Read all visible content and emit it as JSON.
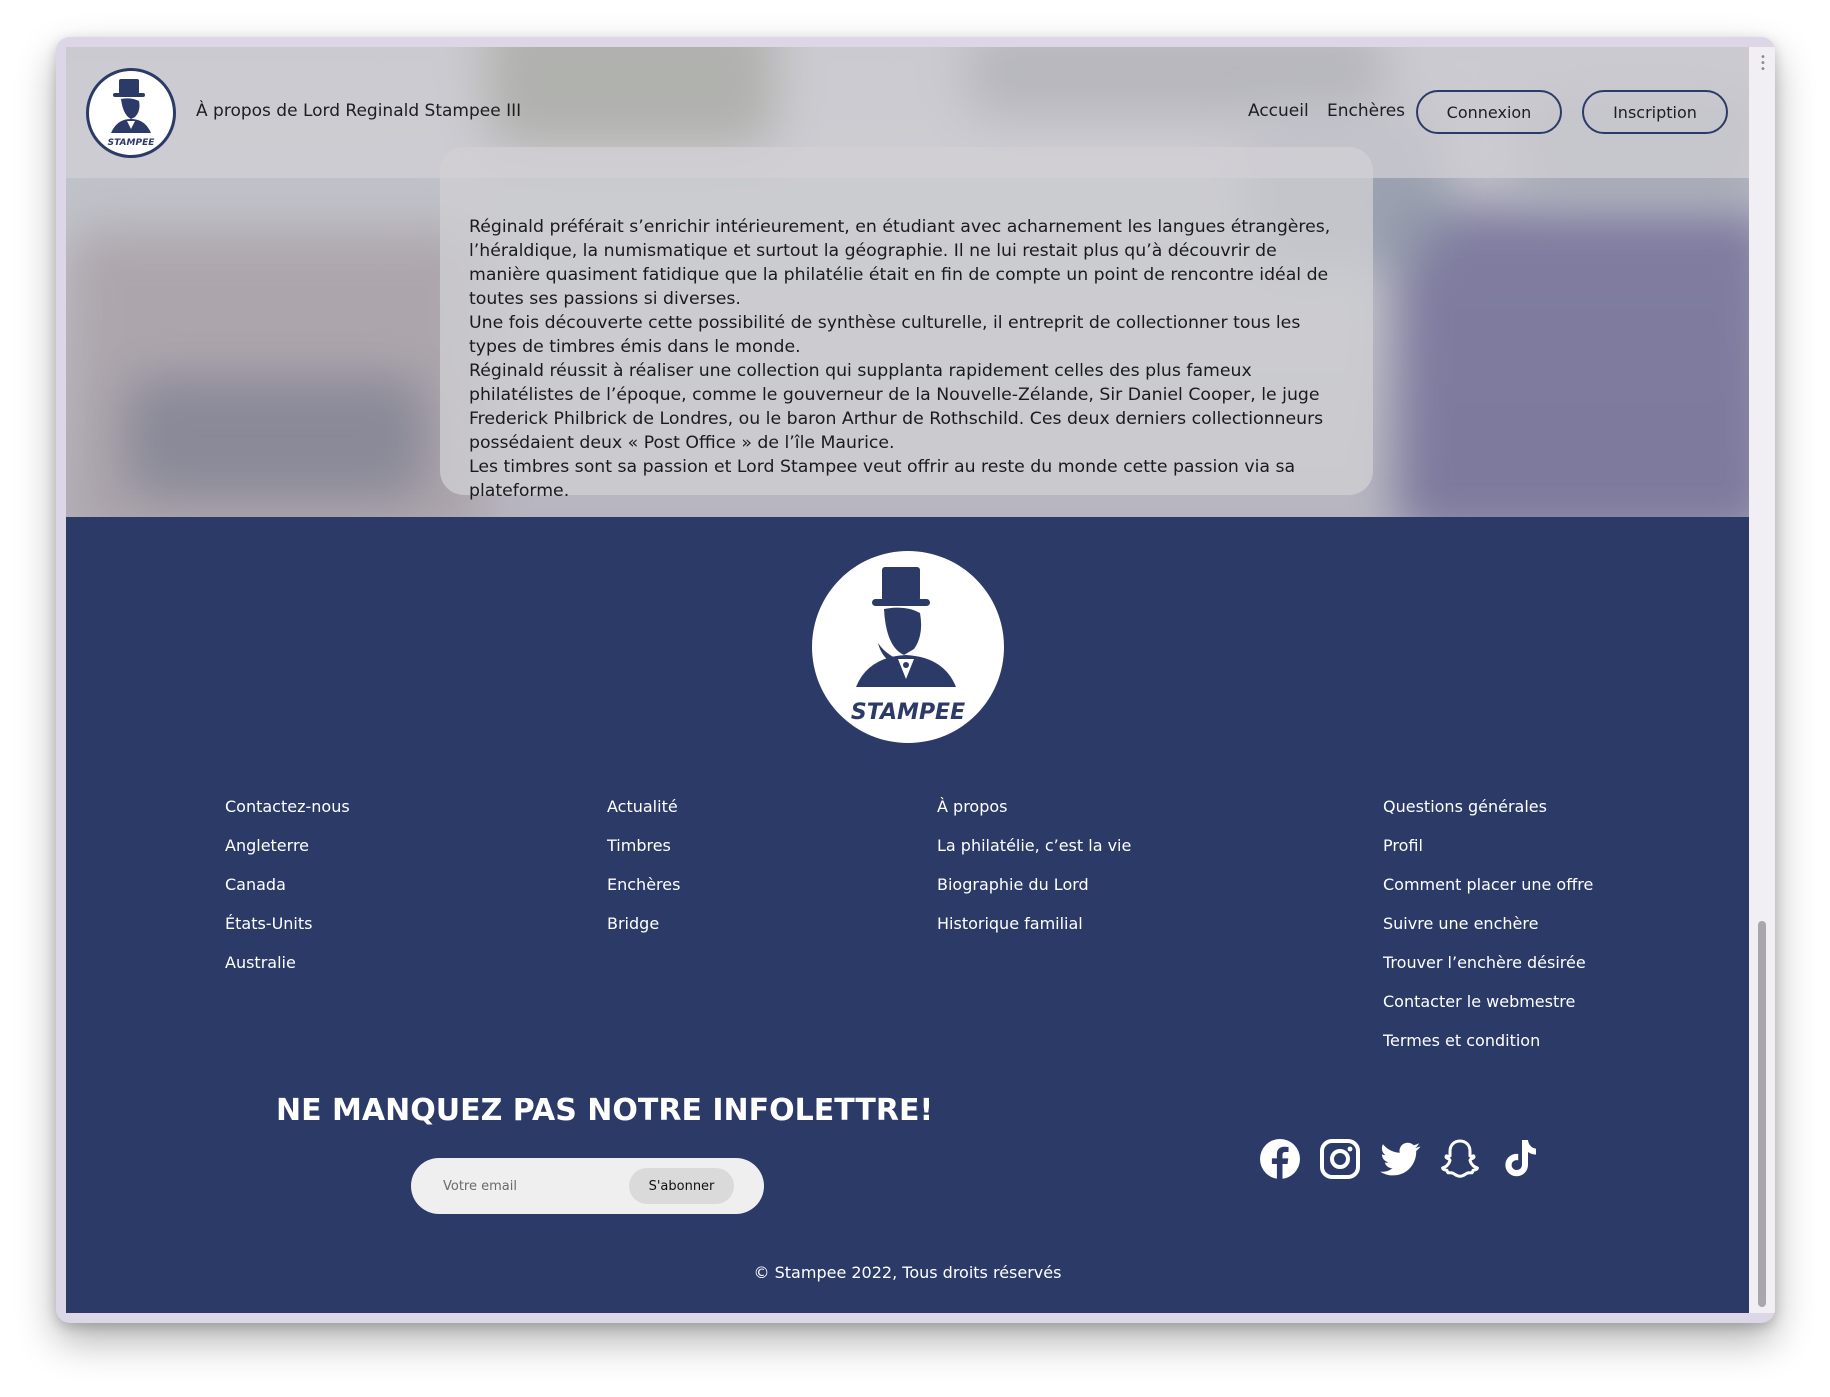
{
  "header": {
    "title": "À propos de Lord Reginald Stampee III",
    "nav": {
      "home": "Accueil",
      "auctions": "Enchères",
      "login": "Connexion",
      "signup": "Inscription"
    },
    "logo_text": "STAMPEE"
  },
  "article": {
    "body": "Réginald préférait s’enrichir intérieurement, en étudiant avec acharnement les langues étrangères, l’héraldique, la numismatique et surtout la géographie. Il ne lui restait plus qu’à découvrir de manière quasiment fatidique que la philatélie était en fin de compte un point de rencontre idéal de toutes ses passions si diverses.\nUne fois découverte cette possibilité de synthèse culturelle, il entreprit de collectionner tous les types de timbres émis dans le monde.\nRéginald réussit à réaliser une collection qui supplanta rapidement celles des plus fameux philatélistes de l’époque, comme le gouverneur de la Nouvelle-Zélande, Sir Daniel Cooper, le juge Frederick Philbrick de Londres, ou le baron Arthur de Rothschild. Ces deux derniers collectionneurs possédaient deux « Post Office » de l’île Maurice.\nLes timbres sont sa passion et Lord Stampee veut offrir au reste du monde cette passion via sa plateforme."
  },
  "footer": {
    "logo_text": "STAMPEE",
    "columns": [
      [
        "Contactez-nous",
        "Angleterre",
        "Canada",
        "États-Units",
        "Australie"
      ],
      [
        "Actualité",
        "Timbres",
        "Enchères",
        "Bridge"
      ],
      [
        "À propos",
        "La philatélie, c’est la vie",
        "Biographie du Lord",
        "Historique familial"
      ],
      [
        "Questions générales",
        "Profil",
        "Comment placer une offre",
        "Suivre une enchère",
        "Trouver l’enchère désirée",
        "Contacter le webmestre",
        "Termes et condition"
      ]
    ],
    "newsletter": {
      "title": "NE MANQUEZ PAS NOTRE INFOLETTRE!",
      "placeholder": "Votre email",
      "button": "S'abonner"
    },
    "social_icons": [
      "facebook-icon",
      "instagram-icon",
      "twitter-icon",
      "snapchat-icon",
      "tiktok-icon"
    ],
    "copyright": "© Stampee 2022, Tous droits réservés"
  },
  "colors": {
    "footer_bg": "#2c3a68",
    "text_light": "#ffffff",
    "brand_navy": "#2c3a68"
  }
}
